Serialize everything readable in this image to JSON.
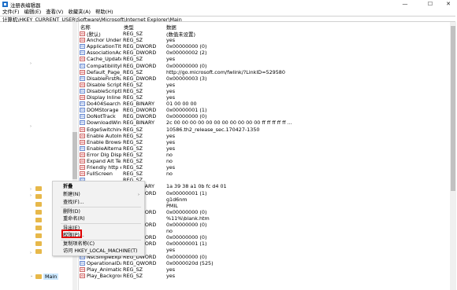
{
  "window": {
    "title": "注册表编辑器",
    "minimize": "—",
    "maximize": "☐",
    "close": "✕"
  },
  "menu": [
    "文件(F)",
    "编辑(E)",
    "查看(V)",
    "收藏夹(A)",
    "帮助(H)"
  ],
  "address": "计算机\\HKEY_CURRENT_USER\\Software\\Microsoft\\Internet Explorer\\Main",
  "tree": {
    "selected": "Main"
  },
  "columns": {
    "name": "名称",
    "type": "类型",
    "data": "数据"
  },
  "rows": [
    {
      "icon": "ab",
      "name": "(默认)",
      "type": "REG_SZ",
      "data": "(数值未设置)"
    },
    {
      "icon": "ab",
      "name": "Anchor Underli...",
      "type": "REG_SZ",
      "data": "yes"
    },
    {
      "icon": "01",
      "name": "ApplicationTitel...",
      "type": "REG_DWORD",
      "data": "0x00000000 (0)"
    },
    {
      "icon": "01",
      "name": "AssociationActi...",
      "type": "REG_DWORD",
      "data": "0x00000002 (2)"
    },
    {
      "icon": "ab",
      "name": "Cache_Update_...",
      "type": "REG_SZ",
      "data": "yes"
    },
    {
      "icon": "01",
      "name": "CompatibilityFl...",
      "type": "REG_DWORD",
      "data": "0x00000000 (0)"
    },
    {
      "icon": "ab",
      "name": "Default_Page_U...",
      "type": "REG_SZ",
      "data": "http://go.microsoft.com/fwlink/?LinkID=529580"
    },
    {
      "icon": "01",
      "name": "DisableFirstRun...",
      "type": "REG_DWORD",
      "data": "0x00000003 (3)"
    },
    {
      "icon": "ab",
      "name": "Disable Script ...",
      "type": "REG_SZ",
      "data": "yes"
    },
    {
      "icon": "01",
      "name": "DisableScriptD...",
      "type": "REG_SZ",
      "data": "yes"
    },
    {
      "icon": "ab",
      "name": "Display Inline I...",
      "type": "REG_SZ",
      "data": "yes"
    },
    {
      "icon": "01",
      "name": "Do404Search",
      "type": "REG_BINARY",
      "data": "01 00 00 00"
    },
    {
      "icon": "01",
      "name": "DOMStorage",
      "type": "REG_DWORD",
      "data": "0x00000001 (1)"
    },
    {
      "icon": "01",
      "name": "DoNotTrack",
      "type": "REG_DWORD",
      "data": "0x00000000 (0)"
    },
    {
      "icon": "01",
      "name": "DownloadWind...",
      "type": "REG_BINARY",
      "data": "2c 00 00 00 00 00 00 00 00 00 00 00 ff ff ff ff ff ..."
    },
    {
      "icon": "ab",
      "name": "EdgeSwitching...",
      "type": "REG_SZ",
      "data": "10586.th2_release_sec.170427-1350"
    },
    {
      "icon": "ab",
      "name": "Enable AutoIm...",
      "type": "REG_SZ",
      "data": "yes"
    },
    {
      "icon": "ab",
      "name": "Enable Browser ...",
      "type": "REG_SZ",
      "data": "yes"
    },
    {
      "icon": "01",
      "name": "EnableAlternati...",
      "type": "REG_SZ",
      "data": "yes"
    },
    {
      "icon": "ab",
      "name": "Error Dlg Displ...",
      "type": "REG_SZ",
      "data": "no"
    },
    {
      "icon": "ab",
      "name": "Expand Alt Text",
      "type": "REG_SZ",
      "data": "no"
    },
    {
      "icon": "ab",
      "name": "Friendly http er...",
      "type": "REG_SZ",
      "data": "yes"
    },
    {
      "icon": "ab",
      "name": "FullScreen",
      "type": "REG_SZ",
      "data": "no"
    },
    {
      "icon": "01",
      "name": "",
      "type": "REG_SZ",
      "data": ""
    },
    {
      "icon": "01",
      "name": "",
      "type": "REG_BINARY",
      "data": "1a 39 38 a1 0b fc d4 01"
    },
    {
      "icon": "01",
      "name": "",
      "type": "REG_DWORD",
      "data": "0x00000001 (1)"
    },
    {
      "icon": "ab",
      "name": "",
      "type": "REG_SZ",
      "data": "g1d6nm"
    },
    {
      "icon": "ab",
      "name": "",
      "type": "REG_SZ",
      "data": "PMIL"
    },
    {
      "icon": "01",
      "name": "",
      "type": "REG_DWORD",
      "data": "0x00000000 (0)"
    },
    {
      "icon": "ab",
      "name": "",
      "type": "REG_SZ",
      "data": "%11%\\blank.htm"
    },
    {
      "icon": "01",
      "name": "",
      "type": "REG_DWORD",
      "data": "0x00000000 (0)"
    },
    {
      "icon": "ab",
      "name": "",
      "type": "REG_SZ",
      "data": "no"
    },
    {
      "icon": "01",
      "name": "",
      "type": "REG_DWORD",
      "data": "0x00000000 (0)"
    },
    {
      "icon": "01",
      "name": "",
      "type": "REG_DWORD",
      "data": "0x00000001 (1)"
    },
    {
      "icon": "ab",
      "name": "NotifyDownloa...",
      "type": "REG_SZ",
      "data": "yes"
    },
    {
      "icon": "01",
      "name": "NscSingleExpa...",
      "type": "REG_DWORD",
      "data": "0x00000000 (0)"
    },
    {
      "icon": "01",
      "name": "OperationalData",
      "type": "REG_QWORD",
      "data": "0x0000020d (525)"
    },
    {
      "icon": "ab",
      "name": "Play_Animations",
      "type": "REG_SZ",
      "data": "yes"
    },
    {
      "icon": "ab",
      "name": "Play_Backgroun...",
      "type": "REG_SZ",
      "data": "yes"
    }
  ],
  "context_menu": {
    "items": [
      "折叠",
      "新建(N)",
      "查找(F)...",
      "删除(D)",
      "重命名(R)",
      "导出(E)",
      "权限(P)...",
      "复制项名称(C)",
      "访问 HKEY_LOCAL_MACHINE(T)"
    ],
    "submenu_arrow": "›",
    "highlighted": "权限(P)..."
  },
  "colors": {
    "highlight_box": "#e00000",
    "selection": "#cce8ff"
  }
}
